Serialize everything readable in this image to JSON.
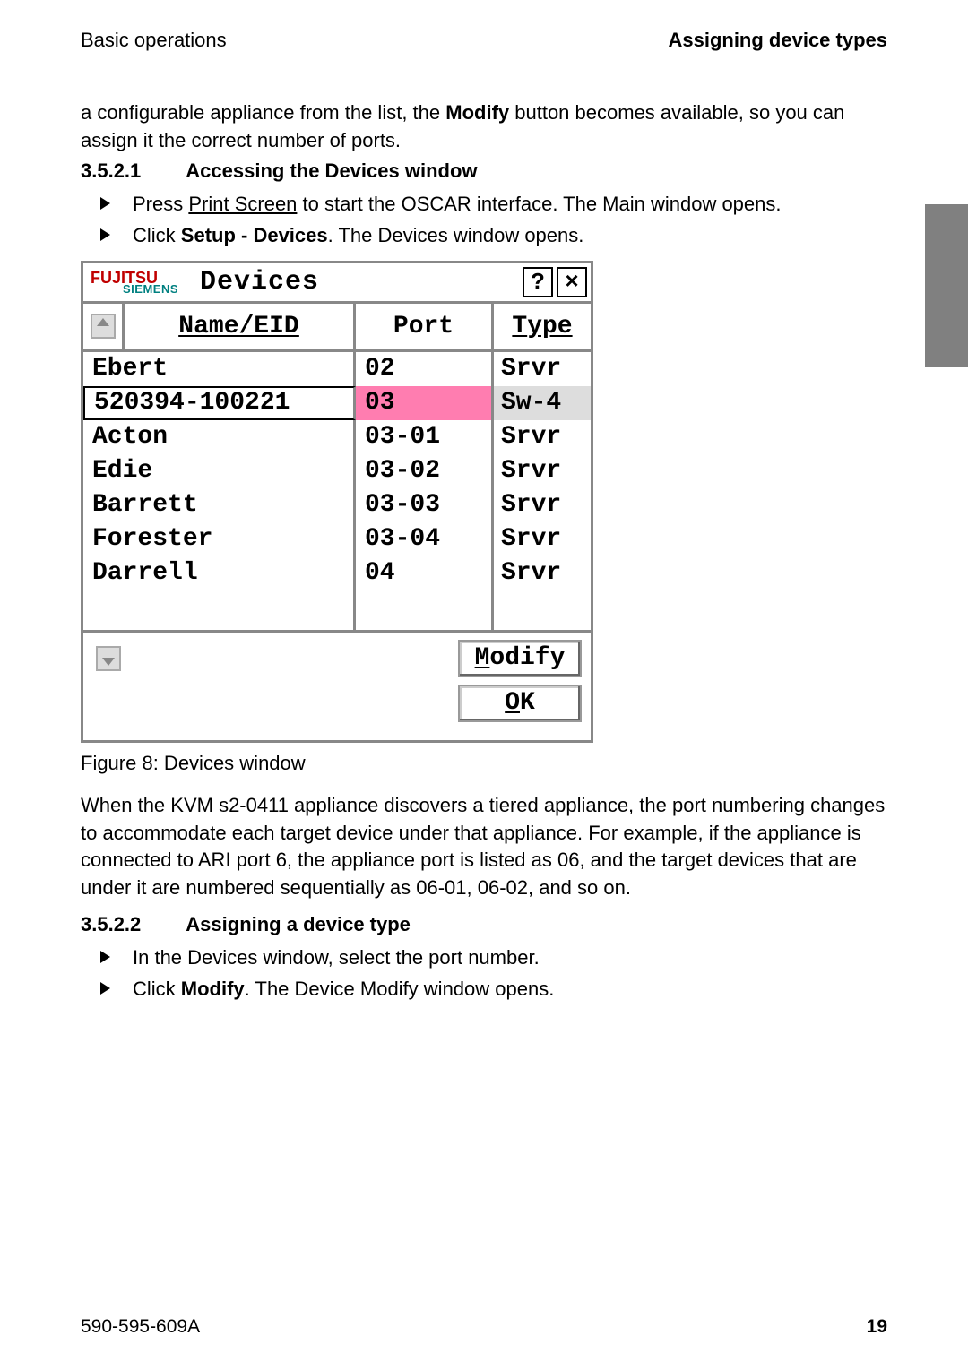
{
  "header": {
    "left": "Basic operations",
    "right": "Assigning device types"
  },
  "intro": {
    "pre": "a configurable appliance from the list, the ",
    "modify": "Modify",
    "post": " button becomes available, so you can assign it the correct number of ports."
  },
  "section1": {
    "num": "3.5.2.1",
    "title": "Accessing the Devices window",
    "bullet1_pre": "Press ",
    "bullet1_link": "Print Screen",
    "bullet1_post": " to start the OSCAR interface. The Main window opens.",
    "bullet2_pre": "Click ",
    "bullet2_bold": "Setup - Devices",
    "bullet2_post": ". The Devices window opens."
  },
  "window": {
    "logo_top": "FUJITSU",
    "logo_sub": "SIEMENS",
    "title": "Devices",
    "help": "?",
    "close": "×",
    "col_name_u": "N",
    "col_name_rest": "ame/EID",
    "col_port": "Port",
    "col_type_u": "T",
    "col_type_rest": "ype",
    "rows": [
      {
        "name": "Ebert",
        "port": "02",
        "type": "Srvr",
        "selected": false
      },
      {
        "name": "520394-100221",
        "port": "03",
        "type": "Sw-4",
        "selected": true
      },
      {
        "name": "Acton",
        "port": "03-01",
        "type": "Srvr",
        "selected": false
      },
      {
        "name": "Edie",
        "port": "03-02",
        "type": "Srvr",
        "selected": false
      },
      {
        "name": "Barrett",
        "port": "03-03",
        "type": "Srvr",
        "selected": false
      },
      {
        "name": "Forester",
        "port": "03-04",
        "type": "Srvr",
        "selected": false
      },
      {
        "name": "Darrell",
        "port": "04",
        "type": "Srvr",
        "selected": false
      }
    ],
    "modify_u": "M",
    "modify_rest": "odify",
    "ok_u": "O",
    "ok_rest": "K"
  },
  "caption": "Figure 8: Devices window",
  "para2": "When the KVM s2-0411 appliance discovers a tiered appliance, the port numbering changes to accommodate each target device under that appliance. For example, if the appliance is connected to ARI port 6, the appliance port is listed as 06, and the target devices that are under it are numbered sequentially as 06-01, 06-02, and so on.",
  "section2": {
    "num": "3.5.2.2",
    "title": "Assigning a device type",
    "bullet1": "In the Devices window, select the port number.",
    "bullet2_pre": "Click ",
    "bullet2_bold": "Modify",
    "bullet2_post": ". The Device Modify window opens."
  },
  "footer": {
    "left": "590-595-609A",
    "right": "19"
  }
}
